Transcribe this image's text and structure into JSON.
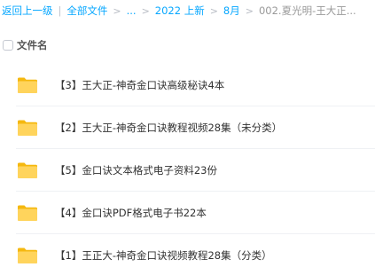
{
  "breadcrumb": {
    "back": "返回上一级",
    "divider": "|",
    "all_files": "全部文件",
    "chevron": ">",
    "ellipsis": "...",
    "year_folder": "2022 上新",
    "month_folder": "8月",
    "current": "002.夏光明-王大正..."
  },
  "header": {
    "column_name": "文件名"
  },
  "files": [
    {
      "name": "【3】王大正-神奇金口诀高级秘诀4本",
      "icon": "folder-icon"
    },
    {
      "name": "【2】王大正-神奇金口诀教程视频28集（未分类）",
      "icon": "folder-icon"
    },
    {
      "name": "【5】金口诀文本格式电子资料23份",
      "icon": "folder-icon"
    },
    {
      "name": "【4】金口诀PDF格式电子书22本",
      "icon": "folder-icon"
    },
    {
      "name": "【1】王正大-神奇金口诀视频教程28集（分类）",
      "icon": "folder-icon"
    }
  ],
  "colors": {
    "accent": "#06a7ff",
    "folder_back": "#f5b80f",
    "folder_front": "#ffd45c"
  }
}
